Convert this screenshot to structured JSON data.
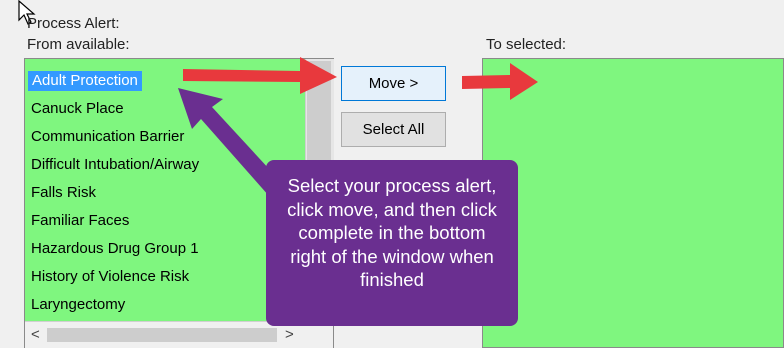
{
  "labels": {
    "process_alert": "Process Alert:",
    "from_available": "From available:",
    "to_selected": "To selected:"
  },
  "available_items": [
    "Adult Protection",
    "Canuck Place",
    "Communication Barrier",
    "Difficult Intubation/Airway",
    "Falls Risk",
    "Familiar Faces",
    "Hazardous Drug Group 1",
    "History of Violence Risk",
    "Laryngectomy"
  ],
  "selected_item": "Adult Protection",
  "buttons": {
    "move": "Move >",
    "select_all": "Select All"
  },
  "scroll": {
    "left_arrow": "<",
    "right_arrow": ">"
  },
  "callout": {
    "text": "Select your process alert, click move, and then click complete in the bottom right of the window when finished"
  },
  "colors": {
    "list_background": "#7ff67f",
    "selection": "#3399ff",
    "arrow": "#e8393d",
    "callout": "#6a2f90"
  },
  "icons": {
    "cursor": "mouse-pointer-icon",
    "annotation_arrows": "red-arrow-icon"
  }
}
